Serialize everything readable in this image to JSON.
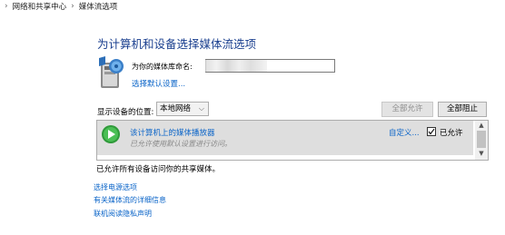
{
  "breadcrumb": {
    "separator": "›",
    "items": [
      "网络和共享中心",
      "媒体流选项"
    ]
  },
  "title": "为计算机和设备选择媒体流选项",
  "library": {
    "label": "为你的媒体库命名:",
    "input_value": "",
    "default_settings_link": "选择默认设置..."
  },
  "device_filter": {
    "label": "显示设备的位置:",
    "selected": "本地网络"
  },
  "buttons": {
    "allow_all": "全部允许",
    "block_all": "全部阻止"
  },
  "devices": [
    {
      "name": "该计算机上的媒体播放器",
      "description": "已允许使用默认设置进行访问。",
      "customize_link": "自定义...",
      "allowed_label": "已允许",
      "allowed": true
    }
  ],
  "status": "已允许所有设备访问你的共享媒体。",
  "links": [
    "选择电源选项",
    "有关媒体流的详细信息",
    "联机阅读隐私声明"
  ],
  "colors": {
    "link": "#0a64c8",
    "title": "#1a3f8f",
    "selected_row": "#dedede",
    "disabled_text": "#8e8e8e"
  },
  "icons": [
    "chevron-right-icon",
    "media-library-icon",
    "chevron-down-icon",
    "media-player-icon",
    "checkmark-icon",
    "scroll-up-icon",
    "scroll-down-icon"
  ]
}
